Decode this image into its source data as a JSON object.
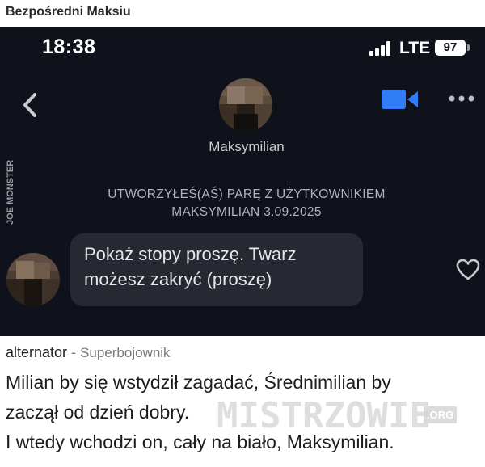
{
  "page": {
    "title": "Bezpośredni Maksiu"
  },
  "status_bar": {
    "time": "18:38",
    "network": "LTE",
    "battery": "97"
  },
  "chat_header": {
    "contact_name": "Maksymilian"
  },
  "watermark_side": "JOE MONSTER",
  "system_message": {
    "line1": "UTWORZYŁEŚ(AŚ) PARĘ Z UŻYTKOWNIKIEM",
    "line2": "MAKSYMILIAN 3.09.2025"
  },
  "message": {
    "line1": "Pokaż stopy proszę. Twarz",
    "line2": "możesz zakryć (proszę)"
  },
  "comment": {
    "author": "alternator",
    "separator": " - ",
    "rank": "Superbojownik",
    "line1": "Milian by się wstydził zagadać, Średnimilian by",
    "line2": "zaczął od dzień dobry.",
    "line3": "I wtedy wchodzi on, cały na biało, Maksymilian."
  },
  "site_brand": {
    "name": "MISTRZOWIE",
    "suffix": ".ORG"
  },
  "colors": {
    "chat_bg": "#0f121a",
    "bubble": "#262832",
    "accent_video": "#2f7cf6"
  },
  "icons": [
    "back-chevron-icon",
    "video-camera-icon",
    "more-dots-icon",
    "heart-icon"
  ]
}
